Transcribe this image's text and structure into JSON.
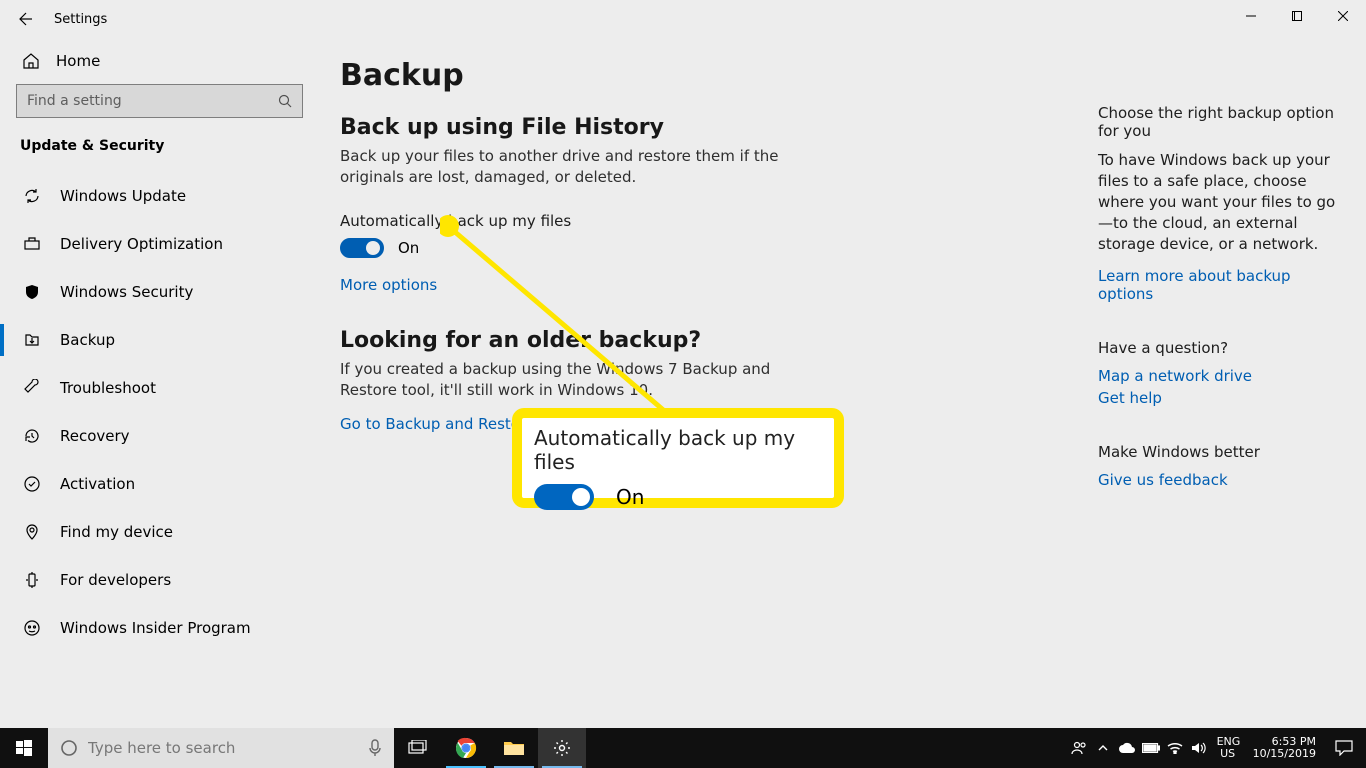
{
  "window": {
    "title": "Settings"
  },
  "sidebar": {
    "home": "Home",
    "search_placeholder": "Find a setting",
    "section": "Update & Security",
    "items": [
      {
        "label": "Windows Update"
      },
      {
        "label": "Delivery Optimization"
      },
      {
        "label": "Windows Security"
      },
      {
        "label": "Backup"
      },
      {
        "label": "Troubleshoot"
      },
      {
        "label": "Recovery"
      },
      {
        "label": "Activation"
      },
      {
        "label": "Find my device"
      },
      {
        "label": "For developers"
      },
      {
        "label": "Windows Insider Program"
      }
    ]
  },
  "page": {
    "title": "Backup",
    "fh_heading": "Back up using File History",
    "fh_body": "Back up your files to another drive and restore them if the originals are lost, damaged, or deleted.",
    "auto_label": "Automatically back up my files",
    "auto_state": "On",
    "more_options": "More options",
    "older_heading": "Looking for an older backup?",
    "older_body": "If you created a backup using the Windows 7 Backup and Restore tool, it'll still work in Windows 10.",
    "older_link": "Go to Backup and Restore (Windows 7)"
  },
  "right": {
    "opt_heading": "Choose the right backup option for you",
    "opt_body": "To have Windows back up your files to a safe place, choose where you want your files to go—to the cloud, an external storage device, or a network.",
    "opt_link": "Learn more about backup options",
    "q_heading": "Have a question?",
    "q_link1": "Map a network drive",
    "q_link2": "Get help",
    "better_heading": "Make Windows better",
    "better_link": "Give us feedback"
  },
  "callout": {
    "label": "Automatically back up my files",
    "state": "On"
  },
  "taskbar": {
    "search_placeholder": "Type here to search",
    "lang1": "ENG",
    "lang2": "US",
    "time": "6:53 PM",
    "date": "10/15/2019"
  }
}
